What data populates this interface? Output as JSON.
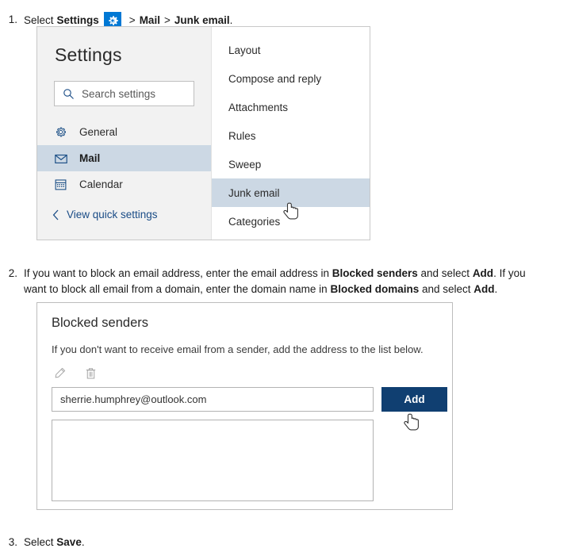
{
  "steps": {
    "one": {
      "number": "1.",
      "lead": "Select",
      "settings_label": "Settings",
      "gear_icon": "gear-icon",
      "sep1": ">",
      "mail_label": "Mail",
      "sep2": ">",
      "junk_label": "Junk email",
      "period": "."
    },
    "two": {
      "number": "2.",
      "text_a": "If you want to block an email address, enter the email address in ",
      "bold_a": "Blocked senders",
      "text_b": " and select ",
      "bold_b": "Add",
      "text_c": ". If you want to block all email from a domain, enter the domain name in ",
      "bold_c": "Blocked domains",
      "text_d": " and select ",
      "bold_d": "Add",
      "text_e": "."
    },
    "three": {
      "number": "3.",
      "lead": "Select",
      "bold": "Save",
      "period": "."
    }
  },
  "settings_panel": {
    "title": "Settings",
    "search": {
      "placeholder": "Search settings",
      "icon": "search-icon"
    },
    "nav_items": [
      {
        "label": "General",
        "icon": "gear-icon",
        "selected": false
      },
      {
        "label": "Mail",
        "icon": "envelope-icon",
        "selected": true
      },
      {
        "label": "Calendar",
        "icon": "calendar-icon",
        "selected": false
      }
    ],
    "quick_settings_link": {
      "label": "View quick settings",
      "icon": "chevron-left-icon"
    },
    "menu_items": [
      {
        "label": "Layout",
        "selected": false
      },
      {
        "label": "Compose and reply",
        "selected": false
      },
      {
        "label": "Attachments",
        "selected": false
      },
      {
        "label": "Rules",
        "selected": false
      },
      {
        "label": "Sweep",
        "selected": false
      },
      {
        "label": "Junk email",
        "selected": true
      },
      {
        "label": "Categories",
        "selected": false
      }
    ]
  },
  "blocked_senders_panel": {
    "title": "Blocked senders",
    "description": "If you don't want to receive email from a sender, add the address to the list below.",
    "tools": [
      {
        "name": "edit-icon",
        "label": "Edit"
      },
      {
        "name": "delete-icon",
        "label": "Delete"
      }
    ],
    "input_value": "sherrie.humphrey@outlook.com",
    "input_placeholder": "",
    "add_button_label": "Add",
    "list_items": []
  },
  "cursors": [
    {
      "name": "pointer-cursor-junk-email"
    },
    {
      "name": "pointer-cursor-add-button"
    }
  ],
  "colors": {
    "accent_blue": "#0078d4",
    "button_navy": "#103f71",
    "selection_blue": "#ccd8e4",
    "sidebar_gray": "#f2f2f2",
    "link_blue": "#1a4c86"
  }
}
